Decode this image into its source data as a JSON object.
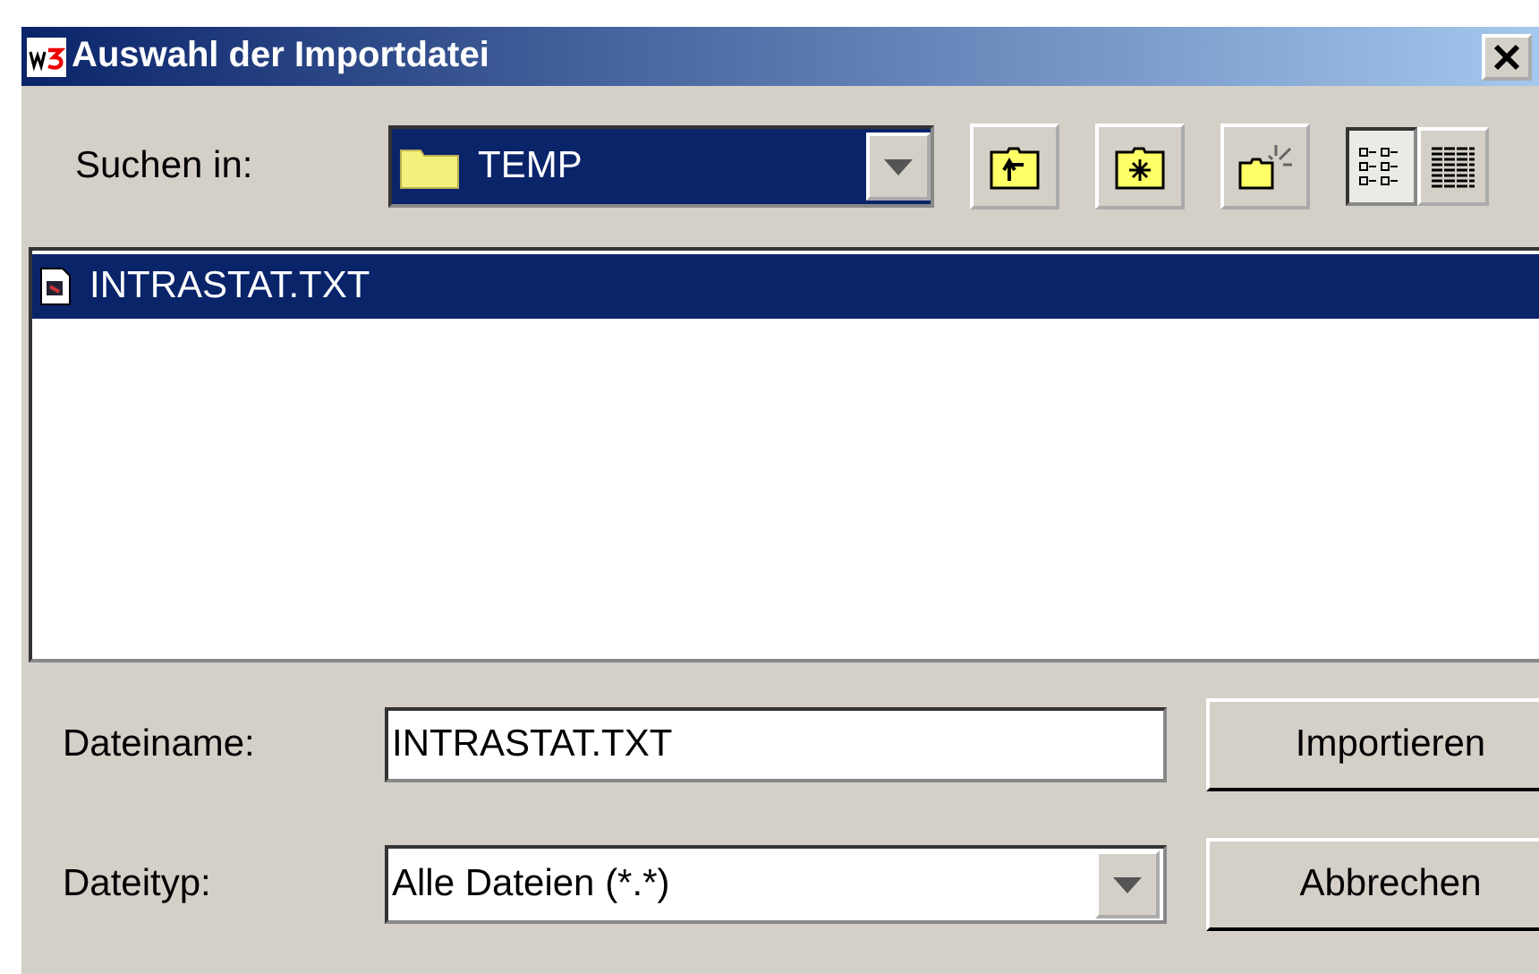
{
  "window": {
    "title": "Auswahl der Importdatei"
  },
  "look_in": {
    "label": "Suchen in:",
    "value": "TEMP"
  },
  "toolbar": [
    {
      "kind": "up"
    },
    {
      "kind": "home"
    },
    {
      "kind": "new"
    }
  ],
  "view_modes": [
    {
      "kind": "list",
      "selected": true
    },
    {
      "kind": "details",
      "selected": false
    }
  ],
  "files": [
    {
      "name": "INTRASTAT.TXT",
      "selected": true
    }
  ],
  "filename": {
    "label": "Dateiname:",
    "value": "INTRASTAT.TXT"
  },
  "filetype": {
    "label": "Dateityp:",
    "value": "Alle Dateien (*.*)"
  },
  "buttons": [
    "Importieren",
    "Abbrechen"
  ]
}
